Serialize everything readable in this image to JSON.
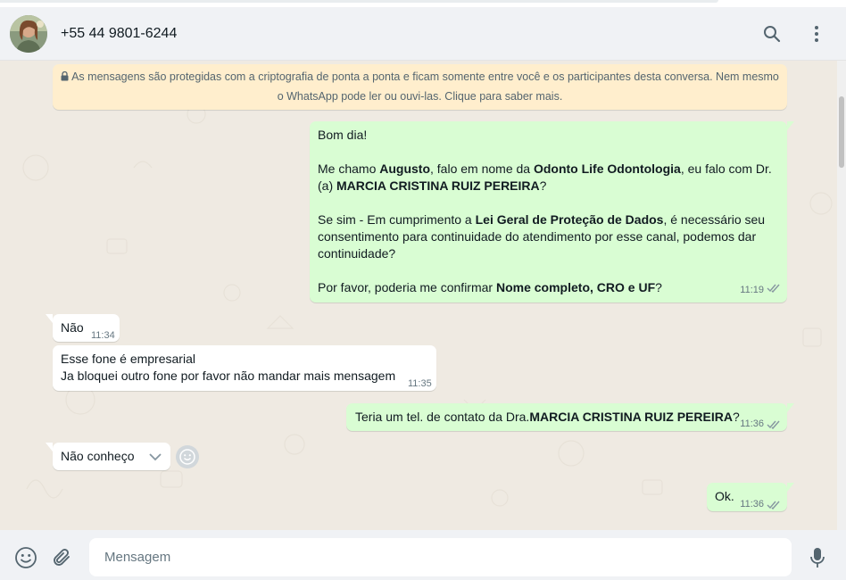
{
  "header": {
    "contact_name": "+55 44 9801-6244",
    "search_icon": "search-icon",
    "menu_icon": "kebab-menu-icon"
  },
  "encryption_notice": {
    "line1": "As mensagens são protegidas com a criptografia de ponta a ponta e ficam somente entre você e os participantes desta conversa. Nem mesmo",
    "line2": "o WhatsApp pode ler ou ouvi-las. Clique para saber mais."
  },
  "messages": [
    {
      "direction": "outgoing",
      "greeting": "Bom dia!",
      "p2_a": "Me chamo ",
      "p2_b": "Augusto",
      "p2_c": ", falo em nome da ",
      "p2_d": "Odonto Life Odontologia",
      "p2_e": ", eu falo com Dr. (a) ",
      "p2_f": "MARCIA CRISTINA RUIZ PEREIRA",
      "p2_g": "?",
      "p3_a": "Se sim - Em cumprimento a ",
      "p3_b": "Lei Geral de Proteção de Dados",
      "p3_c": ", é necessário seu consentimento para continuidade do atendimento por esse canal, podemos dar continuidade?",
      "p4_a": "Por favor, poderia me confirmar ",
      "p4_b": "Nome completo, CRO e UF",
      "p4_c": "?",
      "time": "11:19",
      "status": "read"
    },
    {
      "direction": "incoming",
      "text": "Não",
      "time": "11:34"
    },
    {
      "direction": "incoming",
      "line1": "Esse fone é empresarial",
      "line2": "Ja bloquei outro fone por favor não mandar mais mensagem",
      "time": "11:35"
    },
    {
      "direction": "outgoing",
      "text_a": "Teria um tel. de contato da Dra.",
      "text_b": "MARCIA CRISTINA RUIZ PEREIRA",
      "text_c": "?",
      "time": "11:36",
      "status": "read"
    },
    {
      "direction": "incoming",
      "text": "Não conheço",
      "time": "",
      "menu_icon": "chevron-down-icon",
      "react_icon": "emoji-icon"
    },
    {
      "direction": "outgoing",
      "text": "Ok.",
      "time": "11:36",
      "status": "read"
    }
  ],
  "composer": {
    "placeholder": "Mensagem",
    "emoji_icon": "emoji-icon",
    "attach_icon": "paperclip-icon",
    "mic_icon": "microphone-icon"
  },
  "colors": {
    "outgoing_bubble": "#d9fdd3",
    "incoming_bubble": "#ffffff",
    "chat_background": "#efeae2",
    "notice_background": "#ffeecd",
    "read_ticks": "#8696a0"
  }
}
